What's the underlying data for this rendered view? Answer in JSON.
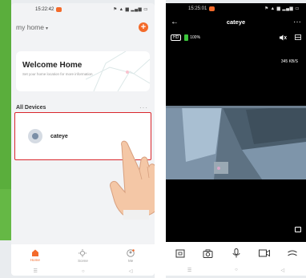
{
  "colors": {
    "accent": "#f36a2a",
    "highlight": "#d9262c",
    "green": "#65b845"
  },
  "phone1": {
    "status_time": "15:22:42",
    "status_icons": "⚑ ▲ ▆ ▂▄▆ ▭",
    "home_name": "my home",
    "home_caret": "▾",
    "add_label": "+",
    "welcome_title": "Welcome Home",
    "welcome_subtitle": "Set your home location for more information",
    "devices_title": "All Devices",
    "more_label": "···",
    "device_name": "cateye",
    "nav": [
      {
        "label": "Home",
        "icon": "home-icon",
        "active": true
      },
      {
        "label": "Scene",
        "icon": "scene-icon",
        "active": false
      },
      {
        "label": "Me",
        "icon": "profile-icon",
        "active": false
      }
    ],
    "sys_nav": [
      "☰",
      "○",
      "◁"
    ]
  },
  "phone2": {
    "status_time": "15:25:01",
    "status_icons": "⚑ ▲ ▆ ▂▄▆ ▭",
    "title": "cateye",
    "back_label": "←",
    "more_label": "···",
    "hd_label": "HD",
    "battery_text": "100%",
    "speed_text": "345 KB/S",
    "controls": [
      "screenshot-icon",
      "camera-icon",
      "microphone-icon",
      "video-record-icon",
      "more-controls-icon"
    ],
    "sys_nav": [
      "☰",
      "○",
      "◁"
    ]
  }
}
